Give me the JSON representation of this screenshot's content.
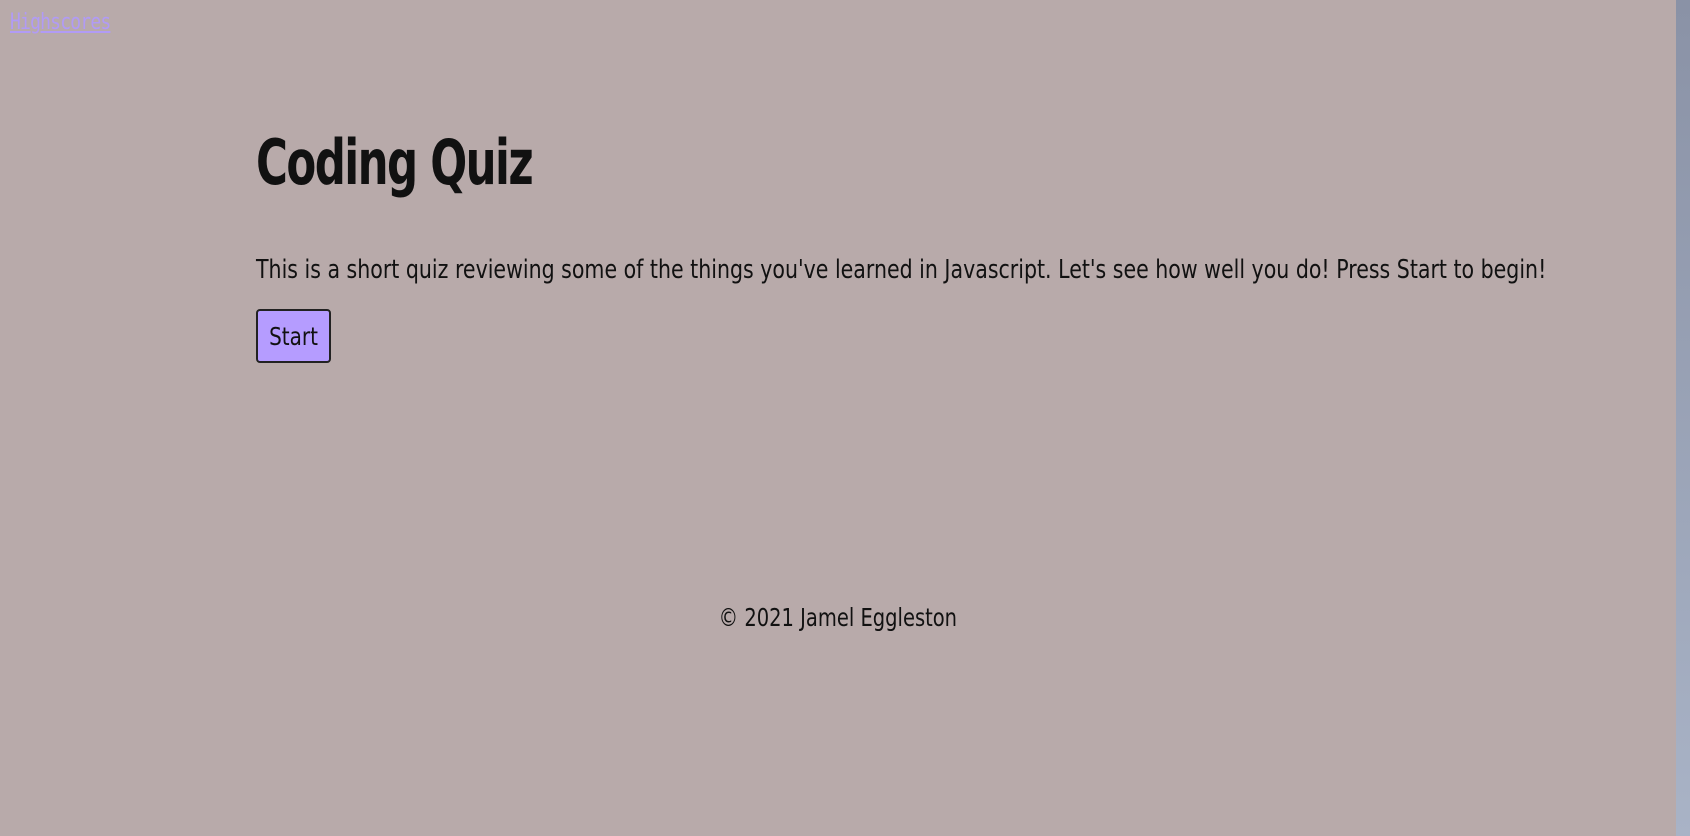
{
  "nav": {
    "highscores_label": "Highscores"
  },
  "main": {
    "title": "Coding Quiz",
    "intro": "This is a short quiz reviewing some of the things you've learned in Javascript. Let's see how well you do! Press Start to begin!",
    "start_label": "Start"
  },
  "footer": {
    "copyright": "© 2021 Jamel Eggleston"
  },
  "colors": {
    "background": "#b8aaaa",
    "accent": "#b59cff",
    "link": "#b19bf5"
  }
}
